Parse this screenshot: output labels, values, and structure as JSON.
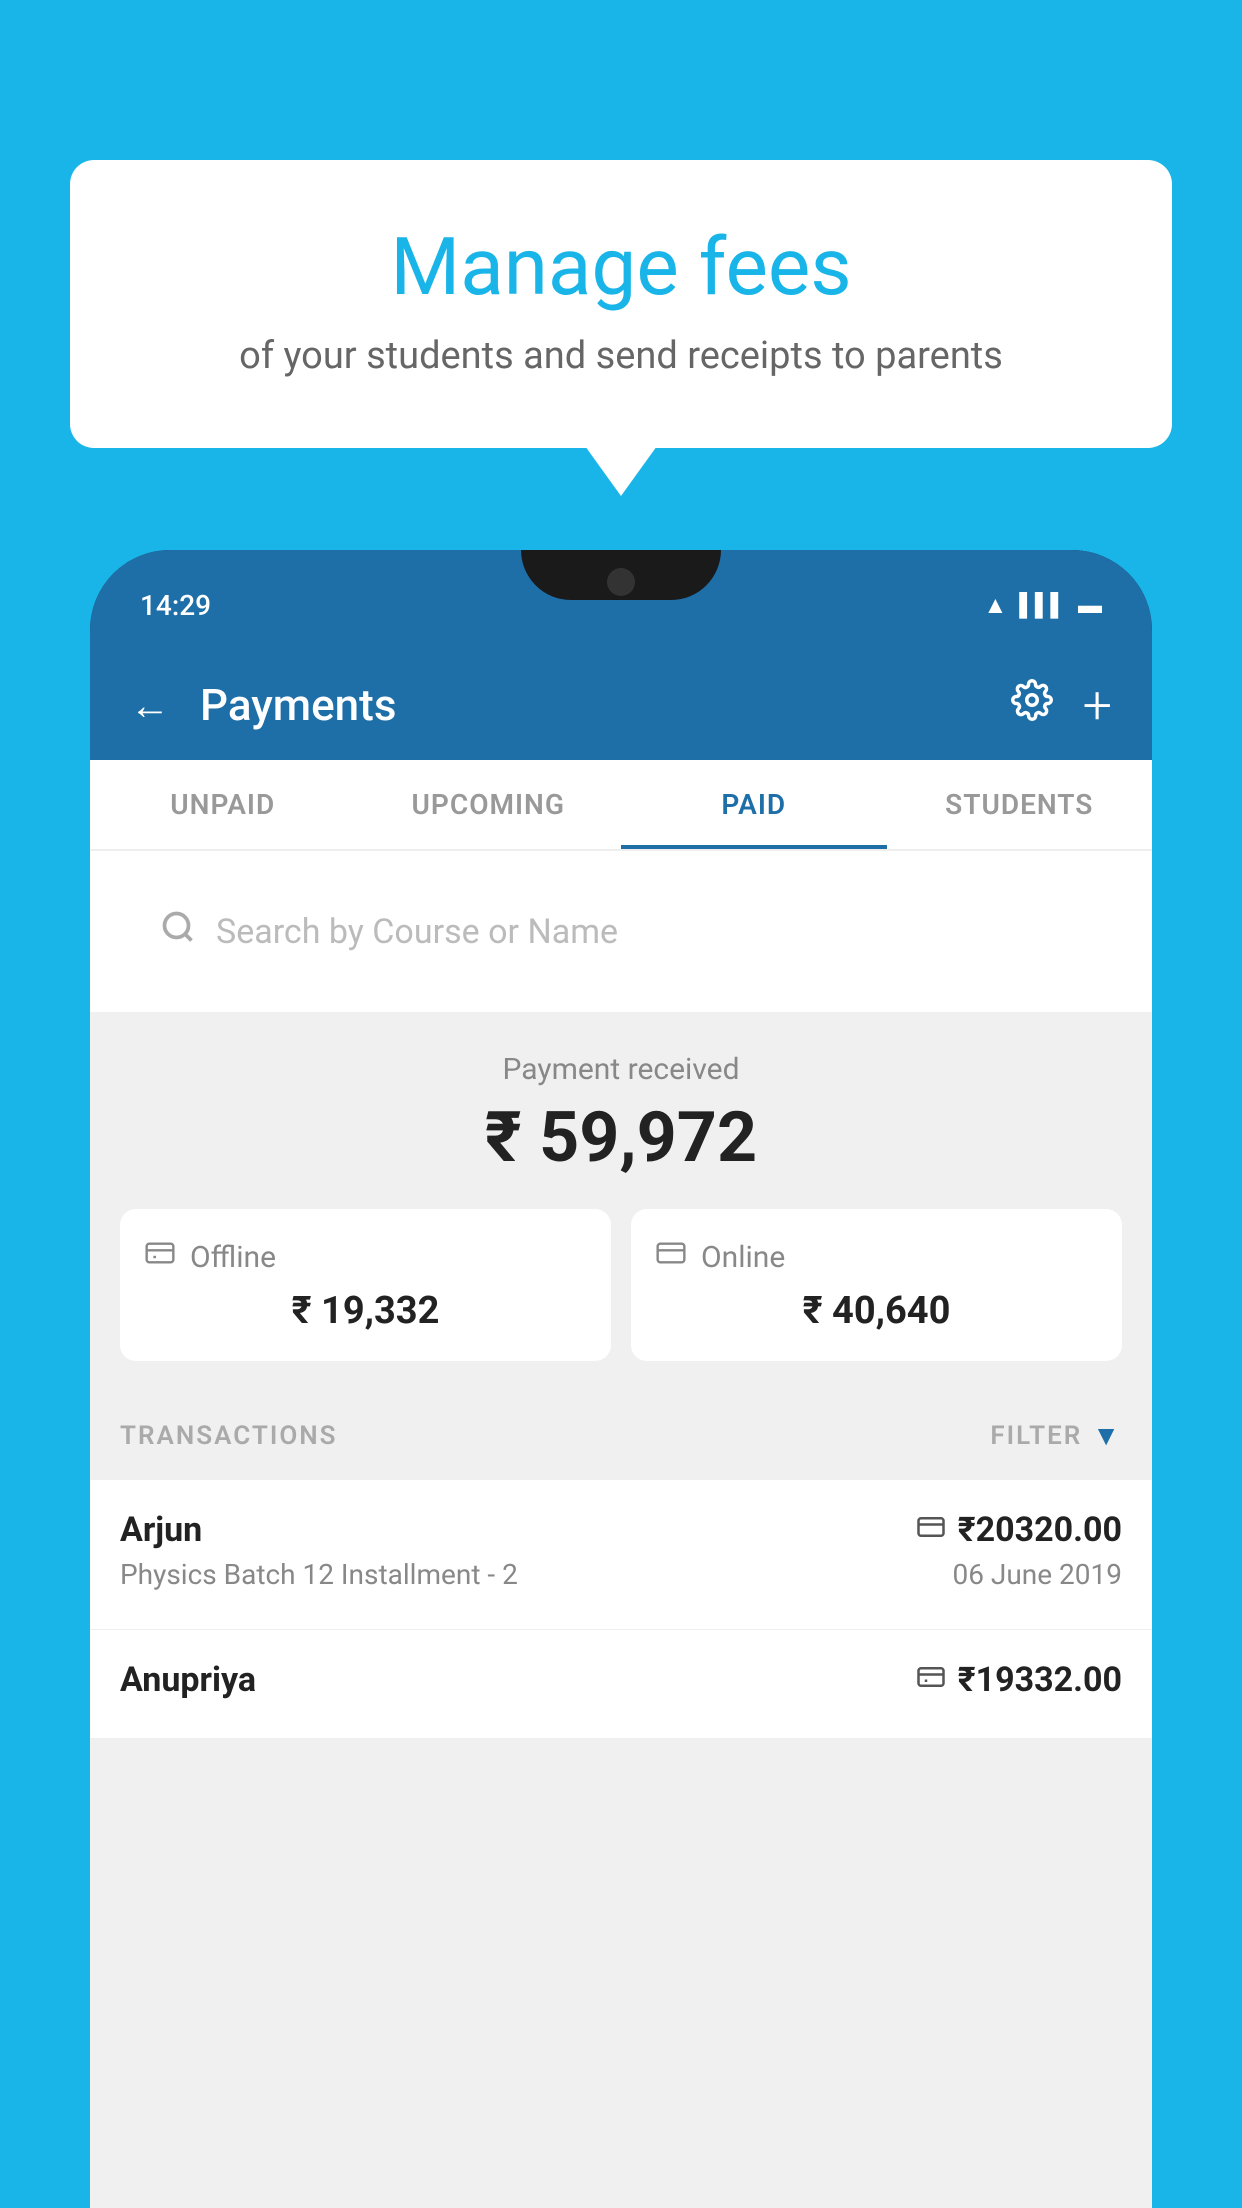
{
  "background_color": "#1ab5e8",
  "speech_bubble": {
    "title": "Manage fees",
    "subtitle": "of your students and send receipts to parents"
  },
  "status_bar": {
    "time": "14:29",
    "icons": [
      "wifi",
      "signal",
      "battery"
    ]
  },
  "app_header": {
    "back_label": "←",
    "title": "Payments",
    "settings_icon": "gear",
    "add_icon": "+"
  },
  "tabs": [
    {
      "label": "UNPAID",
      "active": false
    },
    {
      "label": "UPCOMING",
      "active": false
    },
    {
      "label": "PAID",
      "active": true
    },
    {
      "label": "STUDENTS",
      "active": false
    }
  ],
  "search": {
    "placeholder": "Search by Course or Name"
  },
  "payment_summary": {
    "label": "Payment received",
    "amount": "₹ 59,972",
    "offline": {
      "label": "Offline",
      "amount": "₹ 19,332"
    },
    "online": {
      "label": "Online",
      "amount": "₹ 40,640"
    }
  },
  "transactions_section": {
    "label": "TRANSACTIONS",
    "filter_label": "FILTER"
  },
  "transactions": [
    {
      "name": "Arjun",
      "course": "Physics Batch 12 Installment - 2",
      "amount": "₹20320.00",
      "date": "06 June 2019",
      "payment_type": "online"
    },
    {
      "name": "Anupriya",
      "course": "",
      "amount": "₹19332.00",
      "date": "",
      "payment_type": "offline"
    }
  ]
}
